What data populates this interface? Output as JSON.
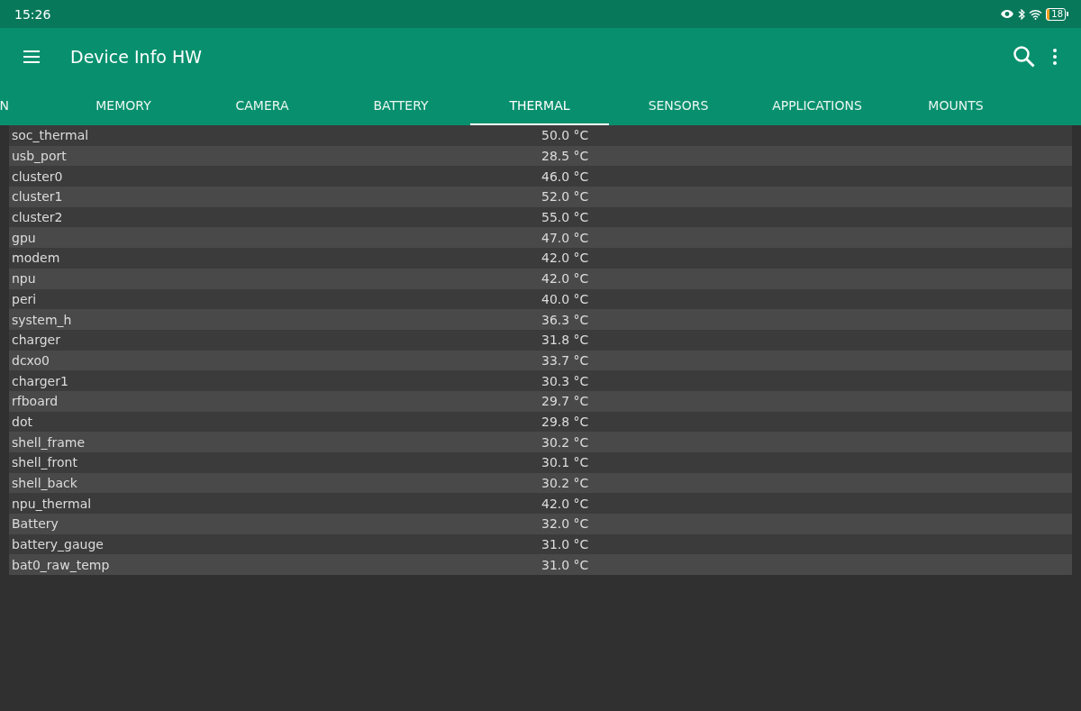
{
  "status_bar": {
    "time": "15:26",
    "battery": "18"
  },
  "app_bar": {
    "title": "Device Info HW"
  },
  "tabs": [
    {
      "label": "N",
      "kind": "cut-start",
      "selected": false
    },
    {
      "label": "MEMORY",
      "kind": "full",
      "selected": false
    },
    {
      "label": "CAMERA",
      "kind": "full",
      "selected": false
    },
    {
      "label": "BATTERY",
      "kind": "full",
      "selected": false
    },
    {
      "label": "THERMAL",
      "kind": "full",
      "selected": true
    },
    {
      "label": "SENSORS",
      "kind": "full",
      "selected": false
    },
    {
      "label": "APPLICATIONS",
      "kind": "full",
      "selected": false
    },
    {
      "label": "MOUNTS",
      "kind": "full",
      "selected": false
    }
  ],
  "table": {
    "rows": [
      {
        "name": "soc_thermal",
        "value": "50.0 °C"
      },
      {
        "name": "usb_port",
        "value": "28.5 °C"
      },
      {
        "name": "cluster0",
        "value": "46.0 °C"
      },
      {
        "name": "cluster1",
        "value": "52.0 °C"
      },
      {
        "name": "cluster2",
        "value": "55.0 °C"
      },
      {
        "name": "gpu",
        "value": "47.0 °C"
      },
      {
        "name": "modem",
        "value": "42.0 °C"
      },
      {
        "name": "npu",
        "value": "42.0 °C"
      },
      {
        "name": "peri",
        "value": "40.0 °C"
      },
      {
        "name": "system_h",
        "value": "36.3 °C"
      },
      {
        "name": "charger",
        "value": "31.8 °C"
      },
      {
        "name": "dcxo0",
        "value": "33.7 °C"
      },
      {
        "name": "charger1",
        "value": "30.3 °C"
      },
      {
        "name": "rfboard",
        "value": "29.7 °C"
      },
      {
        "name": "dot",
        "value": "29.8 °C"
      },
      {
        "name": "shell_frame",
        "value": "30.2 °C"
      },
      {
        "name": "shell_front",
        "value": "30.1 °C"
      },
      {
        "name": "shell_back",
        "value": "30.2 °C"
      },
      {
        "name": "npu_thermal",
        "value": "42.0 °C"
      },
      {
        "name": "Battery",
        "value": "32.0 °C"
      },
      {
        "name": "battery_gauge",
        "value": "31.0 °C"
      },
      {
        "name": "bat0_raw_temp",
        "value": "31.0 °C"
      }
    ]
  }
}
